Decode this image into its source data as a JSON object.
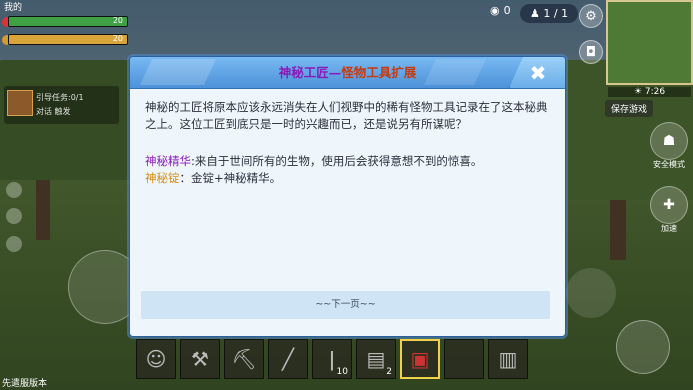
{
  "hud": {
    "player_label": "我的",
    "hp_value": "20",
    "food_value": "20",
    "hp_fraction": 1.0,
    "food_fraction": 1.0,
    "currency_count": "0",
    "players_count": "1 / 1",
    "time": "7:26",
    "save_label": "保存游戏",
    "task_lines": [
      "引导任务:0/1",
      "对话 触发"
    ],
    "side_buttons": [
      "安全模式",
      "加速"
    ],
    "version_label": "先遣服版本"
  },
  "hotbar": {
    "slots": [
      {
        "icon": "smiley-icon",
        "count": ""
      },
      {
        "icon": "axe-icon",
        "count": ""
      },
      {
        "icon": "pickaxe-icon",
        "count": ""
      },
      {
        "icon": "club-icon",
        "count": ""
      },
      {
        "icon": "torch-icon",
        "count": "10"
      },
      {
        "icon": "book-icon",
        "count": "2"
      },
      {
        "icon": "red-book-icon",
        "count": "",
        "active": true
      },
      {
        "icon": "empty-slot",
        "count": ""
      },
      {
        "icon": "backpack-icon",
        "count": ""
      }
    ]
  },
  "dialog": {
    "title_part1": "神秘工匠—",
    "title_part2": "怪物工具扩展",
    "intro": "神秘的工匠将原本应该永远消失在人们视野中的稀有怪物工具记录在了这本秘典之上。这位工匠到底只是一时的兴趣而已，还是说另有所谋呢？",
    "line1_key": "神秘精华",
    "line1_rest": ":来自于世间所有的生物，使用后会获得意想不到的惊喜。",
    "line2_key": "神秘锭",
    "line2_rest": "：金锭+神秘精华。",
    "next_label": "~~下一页~~",
    "close_icon": "close-icon"
  },
  "colors": {
    "title_purple": "#8a1bb8",
    "title_red": "#c73a0f",
    "key_purple": "#8a1bb8",
    "key_orange": "#d68a12",
    "dialog_bg": "#eef6fc",
    "header_blue": "#4d92d9"
  }
}
